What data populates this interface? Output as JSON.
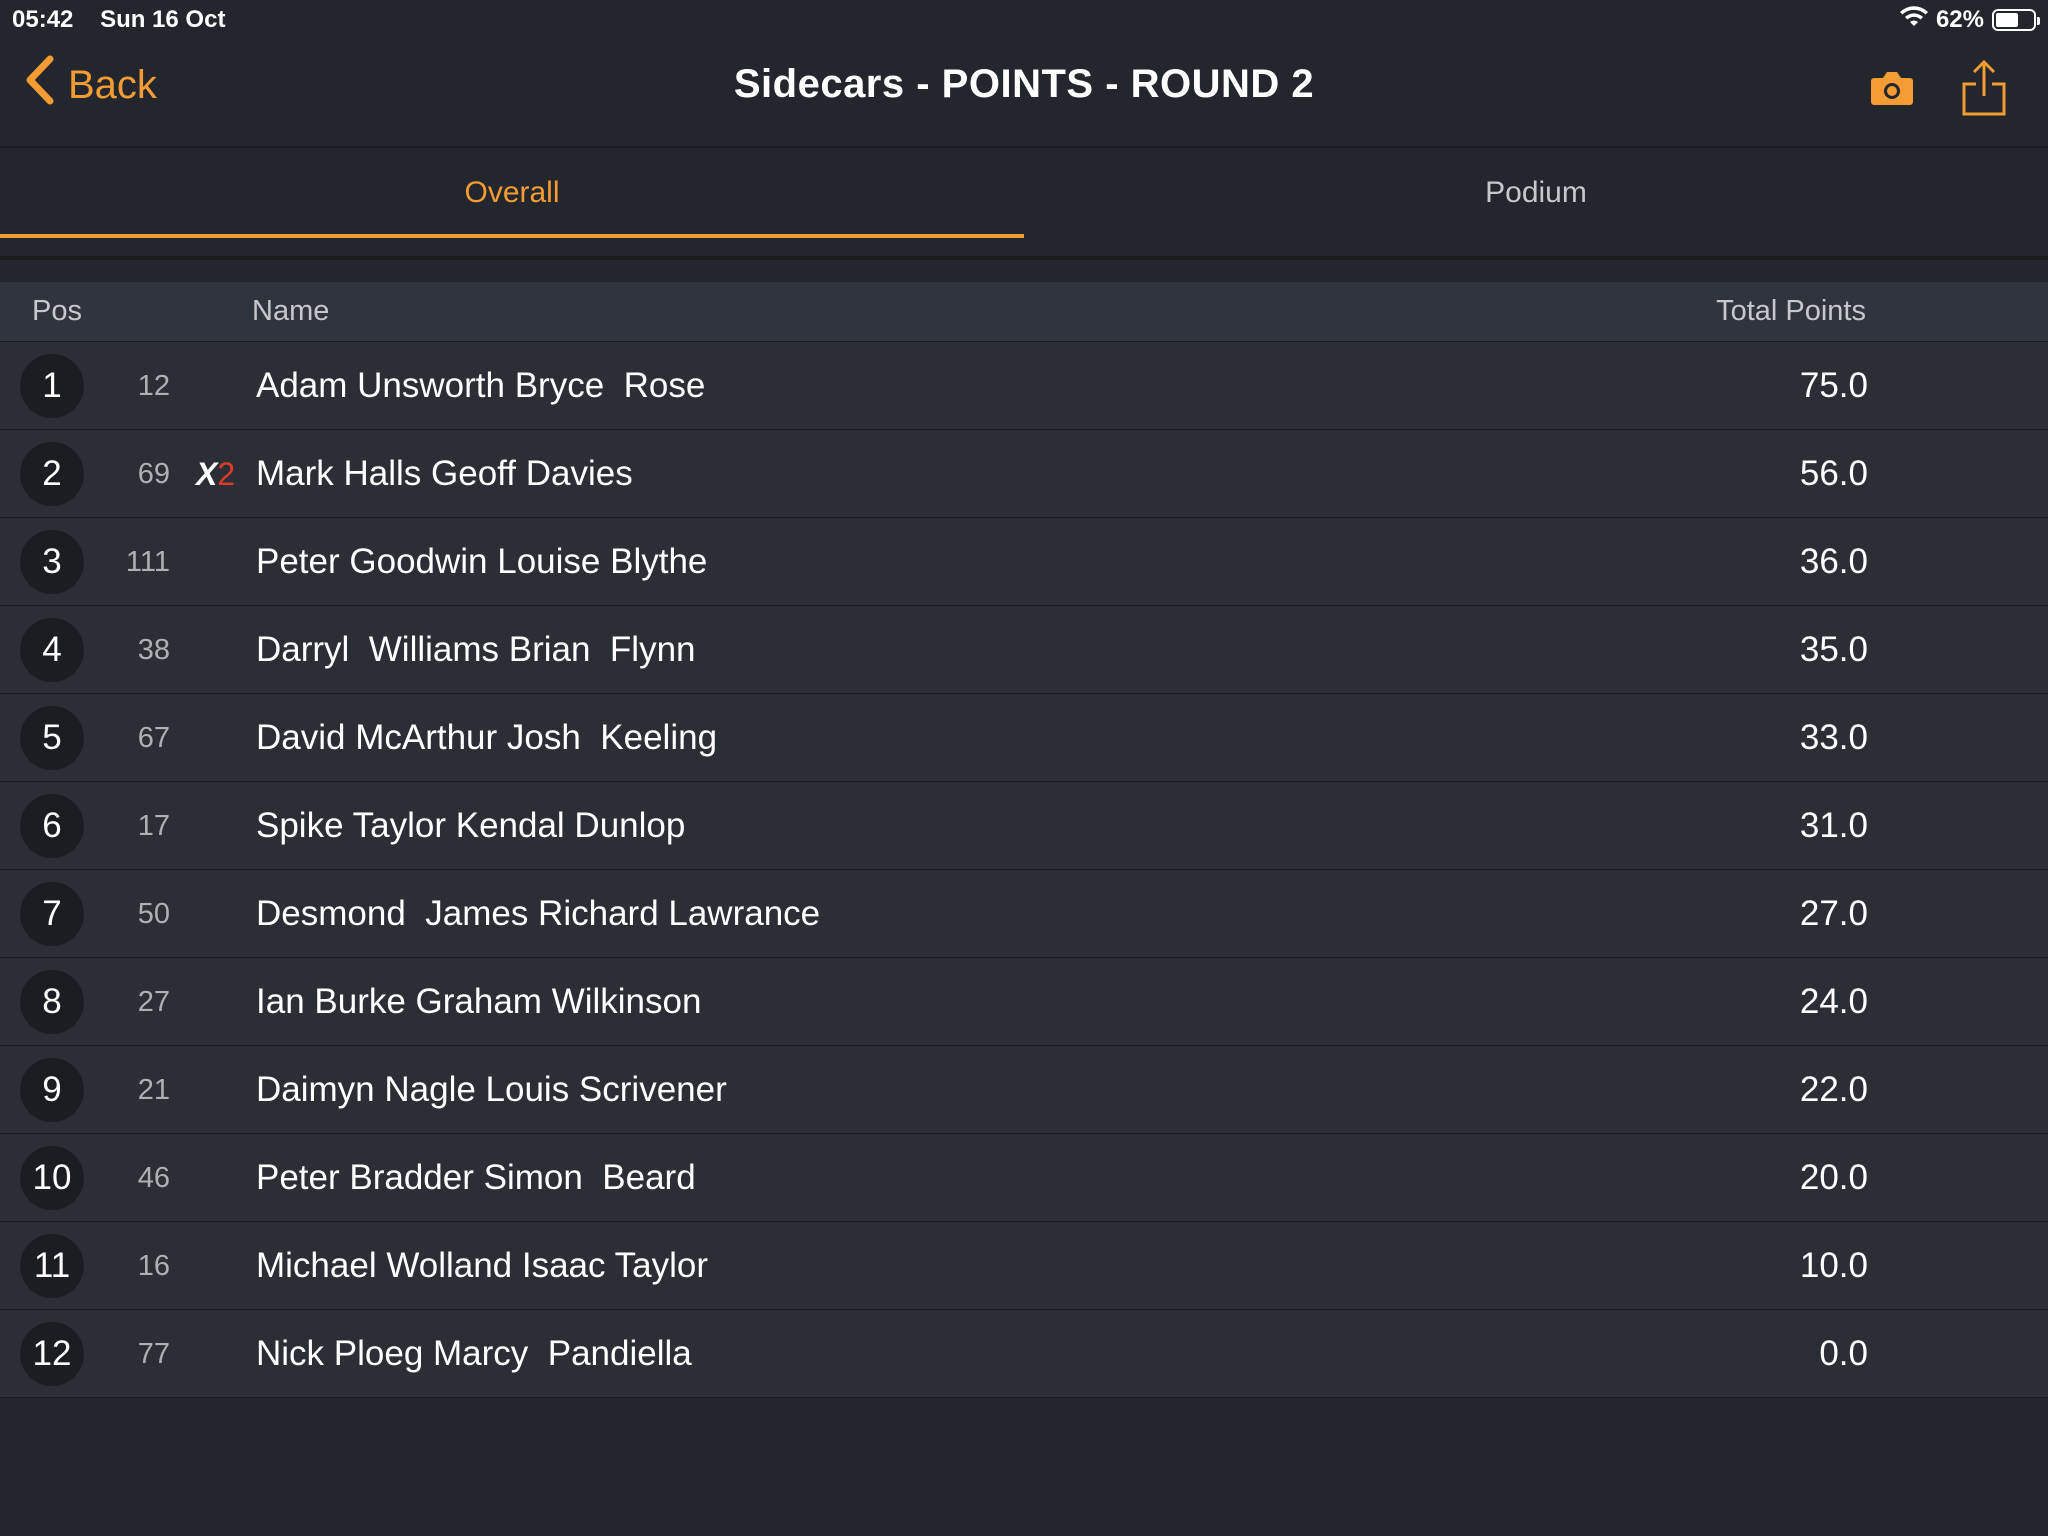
{
  "status_bar": {
    "time": "05:42",
    "date": "Sun 16 Oct",
    "battery": "62%",
    "battery_level": 0.62
  },
  "nav": {
    "back_label": "Back",
    "title": "Sidecars - POINTS - ROUND 2",
    "accent_color": "#f39c33"
  },
  "tabs": [
    {
      "label": "Overall",
      "active": true
    },
    {
      "label": "Podium",
      "active": false
    }
  ],
  "table": {
    "headers": {
      "pos": "Pos",
      "name": "Name",
      "points": "Total Points"
    },
    "rows": [
      {
        "pos": "1",
        "number": "12",
        "badge": "",
        "name": "Adam Unsworth Bryce  Rose",
        "points": "75.0"
      },
      {
        "pos": "2",
        "number": "69",
        "badge": "X2",
        "name": "Mark Halls Geoff Davies",
        "points": "56.0"
      },
      {
        "pos": "3",
        "number": "111",
        "badge": "",
        "name": "Peter Goodwin Louise Blythe",
        "points": "36.0"
      },
      {
        "pos": "4",
        "number": "38",
        "badge": "",
        "name": "Darryl  Williams Brian  Flynn",
        "points": "35.0"
      },
      {
        "pos": "5",
        "number": "67",
        "badge": "",
        "name": "David McArthur Josh  Keeling",
        "points": "33.0"
      },
      {
        "pos": "6",
        "number": "17",
        "badge": "",
        "name": "Spike Taylor Kendal Dunlop",
        "points": "31.0"
      },
      {
        "pos": "7",
        "number": "50",
        "badge": "",
        "name": "Desmond  James Richard Lawrance",
        "points": "27.0"
      },
      {
        "pos": "8",
        "number": "27",
        "badge": "",
        "name": "Ian Burke Graham Wilkinson",
        "points": "24.0"
      },
      {
        "pos": "9",
        "number": "21",
        "badge": "",
        "name": "Daimyn Nagle Louis Scrivener",
        "points": "22.0"
      },
      {
        "pos": "10",
        "number": "46",
        "badge": "",
        "name": "Peter Bradder Simon  Beard",
        "points": "20.0"
      },
      {
        "pos": "11",
        "number": "16",
        "badge": "",
        "name": "Michael Wolland Isaac Taylor",
        "points": "10.0"
      },
      {
        "pos": "12",
        "number": "77",
        "badge": "",
        "name": "Nick Ploeg Marcy  Pandiella",
        "points": "0.0"
      }
    ]
  }
}
